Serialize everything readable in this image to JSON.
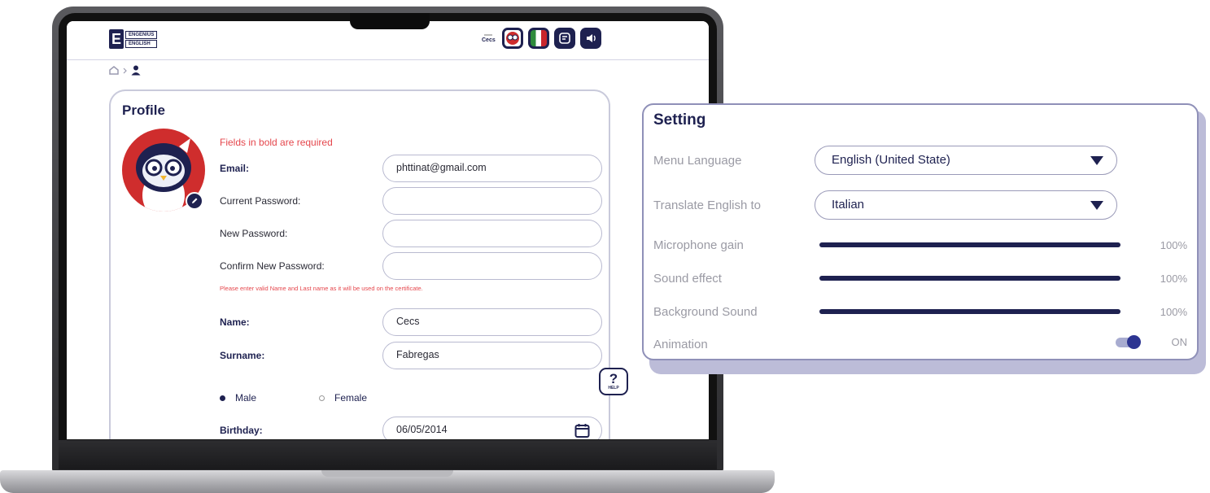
{
  "brand": {
    "line1": "ENGENIUS",
    "line2": "ENGLISH",
    "mark": "E"
  },
  "header": {
    "user_name": "Cecs",
    "icons": [
      "owl-avatar-icon",
      "italy-flag-icon",
      "notes-icon",
      "sound-icon"
    ]
  },
  "profile": {
    "title": "Profile",
    "required_note": "Fields in bold are required",
    "email_label": "Email:",
    "email_value": "phttinat@gmail.com",
    "current_password_label": "Current Password:",
    "current_password_value": "",
    "new_password_label": "New Password:",
    "new_password_value": "",
    "confirm_password_label": "Confirm New Password:",
    "confirm_password_value": "",
    "certificate_note": "Please enter valid Name and Last name as it will be used on the certificate.",
    "name_label": "Name:",
    "name_value": "Cecs",
    "surname_label": "Surname:",
    "surname_value": "Fabregas",
    "gender_male": "Male",
    "gender_female": "Female",
    "gender_selected": "Male",
    "birthday_label": "Birthday:",
    "birthday_value": "06/05/2014"
  },
  "help": {
    "symbol": "?",
    "label": "HELP"
  },
  "settings": {
    "title": "Setting",
    "menu_language_label": "Menu Language",
    "menu_language_value": "English (United State)",
    "translate_label": "Translate English to",
    "translate_value": "Italian",
    "mic_label": "Microphone gain",
    "mic_value": "100%",
    "mic_level": 1.0,
    "sound_label": "Sound effect",
    "sound_value": "100%",
    "sound_level": 1.0,
    "bg_label": "Background Sound",
    "bg_value": "100%",
    "bg_level": 1.0,
    "animation_label": "Animation",
    "animation_state": "ON",
    "colors": {
      "navy": "#1e2150",
      "required_red": "#e5474d",
      "muted": "#9a9aa4"
    }
  }
}
